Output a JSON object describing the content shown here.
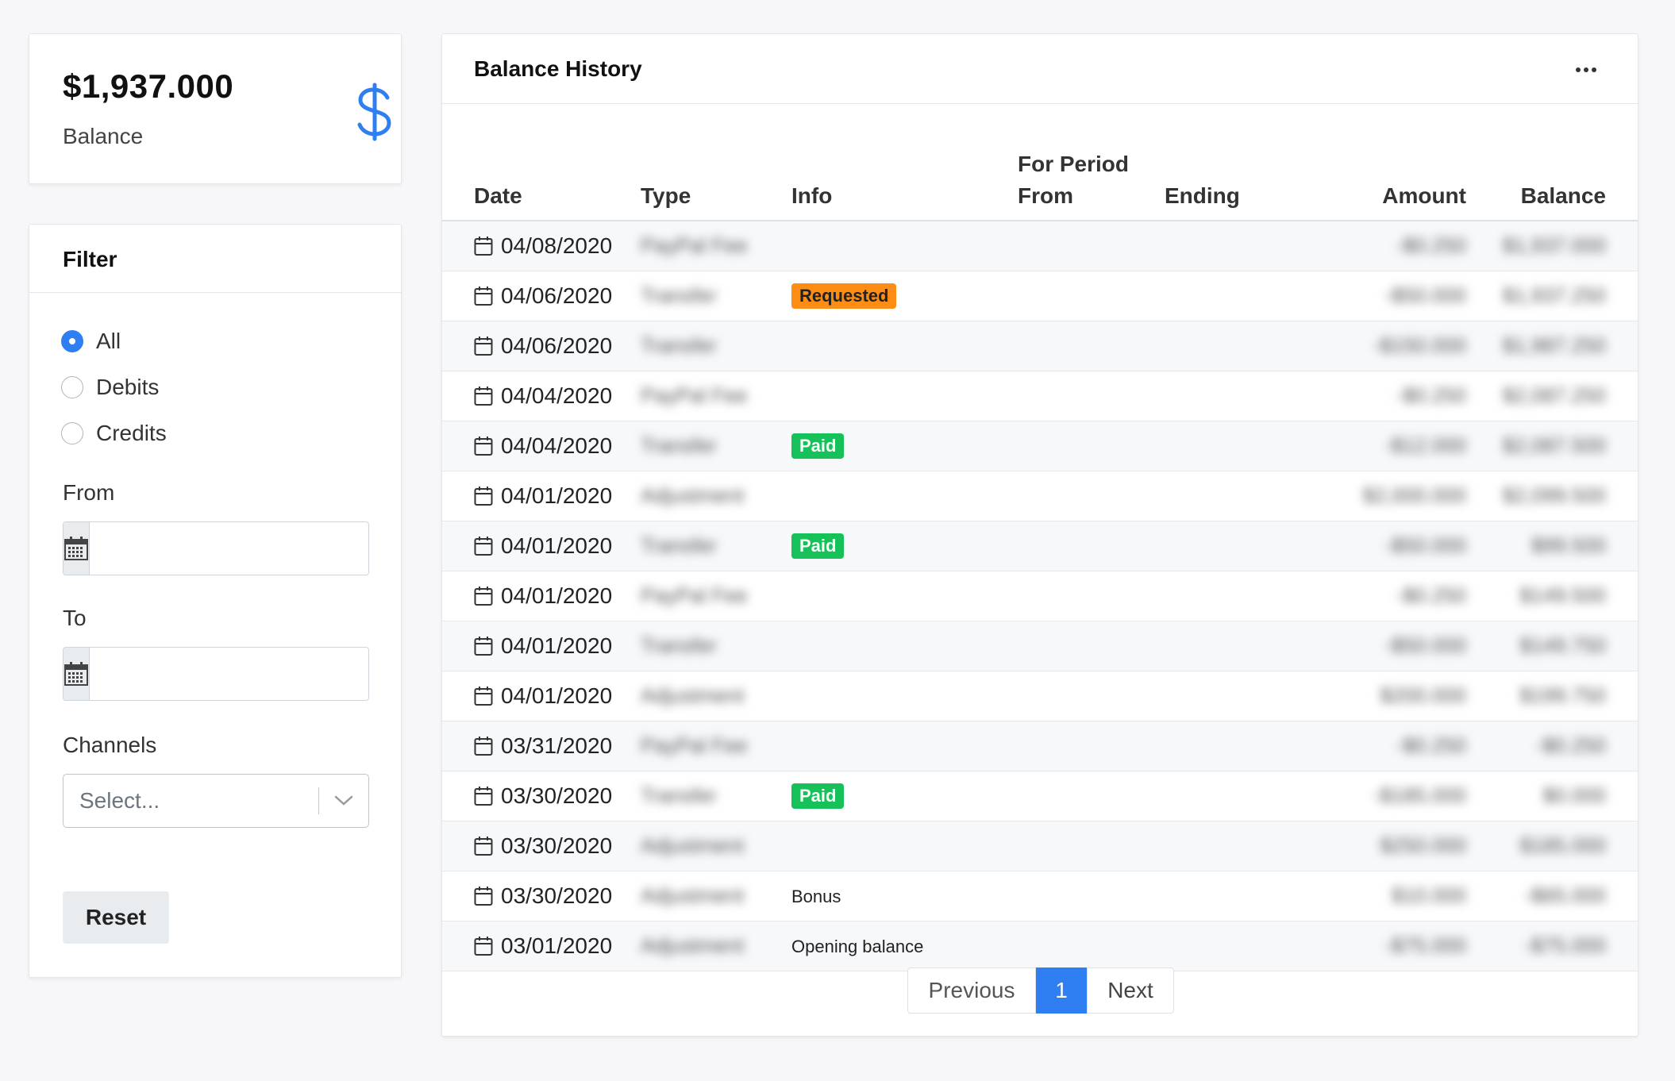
{
  "balance": {
    "amount": "$1,937.000",
    "label": "Balance",
    "icon": "dollar-icon",
    "accent": "#2f7ff2"
  },
  "filter": {
    "title": "Filter",
    "options": [
      {
        "label": "All",
        "checked": true
      },
      {
        "label": "Debits",
        "checked": false
      },
      {
        "label": "Credits",
        "checked": false
      }
    ],
    "from_label": "From",
    "from_value": "",
    "to_label": "To",
    "to_value": "",
    "channels_label": "Channels",
    "channels_placeholder": "Select...",
    "reset_label": "Reset"
  },
  "history": {
    "title": "Balance History",
    "columns": {
      "date": "Date",
      "type": "Type",
      "info": "Info",
      "period": "For Period",
      "from": "From",
      "ending": "Ending",
      "amount": "Amount",
      "balance": "Balance"
    },
    "rows": [
      {
        "date": "04/08/2020",
        "type": "PayPal Fee",
        "info": "",
        "badge": "",
        "amount": "-$0.250",
        "balance": "$1,937.000"
      },
      {
        "date": "04/06/2020",
        "type": "Transfer",
        "info": "",
        "badge": "Requested",
        "badge_color": "#fd8d14",
        "amount": "-$50.000",
        "balance": "$1,937.250"
      },
      {
        "date": "04/06/2020",
        "type": "Transfer",
        "info": "",
        "badge": "",
        "amount": "-$150.000",
        "balance": "$1,987.250"
      },
      {
        "date": "04/04/2020",
        "type": "PayPal Fee",
        "info": "",
        "badge": "",
        "amount": "-$0.250",
        "balance": "$2,087.250"
      },
      {
        "date": "04/04/2020",
        "type": "Transfer",
        "info": "",
        "badge": "Paid",
        "badge_color": "#17c15a",
        "amount": "-$12.000",
        "balance": "$2,087.500"
      },
      {
        "date": "04/01/2020",
        "type": "Adjustment",
        "info": "",
        "badge": "",
        "amount": "$2,000.000",
        "balance": "$2,099.500"
      },
      {
        "date": "04/01/2020",
        "type": "Transfer",
        "info": "",
        "badge": "Paid",
        "badge_color": "#17c15a",
        "amount": "-$50.000",
        "balance": "$99.500"
      },
      {
        "date": "04/01/2020",
        "type": "PayPal Fee",
        "info": "",
        "badge": "",
        "amount": "-$0.250",
        "balance": "$149.500"
      },
      {
        "date": "04/01/2020",
        "type": "Transfer",
        "info": "",
        "badge": "",
        "amount": "-$50.000",
        "balance": "$149.750"
      },
      {
        "date": "04/01/2020",
        "type": "Adjustment",
        "info": "",
        "badge": "",
        "amount": "$200.000",
        "balance": "$199.750"
      },
      {
        "date": "03/31/2020",
        "type": "PayPal Fee",
        "info": "",
        "badge": "",
        "amount": "-$0.250",
        "balance": "-$0.250"
      },
      {
        "date": "03/30/2020",
        "type": "Transfer",
        "info": "",
        "badge": "Paid",
        "badge_color": "#17c15a",
        "amount": "-$185.000",
        "balance": "$0.000"
      },
      {
        "date": "03/30/2020",
        "type": "Adjustment",
        "info": "",
        "badge": "",
        "amount": "$250.000",
        "balance": "$185.000"
      },
      {
        "date": "03/30/2020",
        "type": "Adjustment",
        "info": "Bonus",
        "badge": "",
        "amount": "$10.000",
        "balance": "-$65.000"
      },
      {
        "date": "03/01/2020",
        "type": "Adjustment",
        "info": "Opening balance",
        "badge": "",
        "amount": "-$75.000",
        "balance": "-$75.000"
      }
    ]
  },
  "pagination": {
    "previous": "Previous",
    "current": "1",
    "next": "Next",
    "active_color": "#2f7ff2"
  }
}
